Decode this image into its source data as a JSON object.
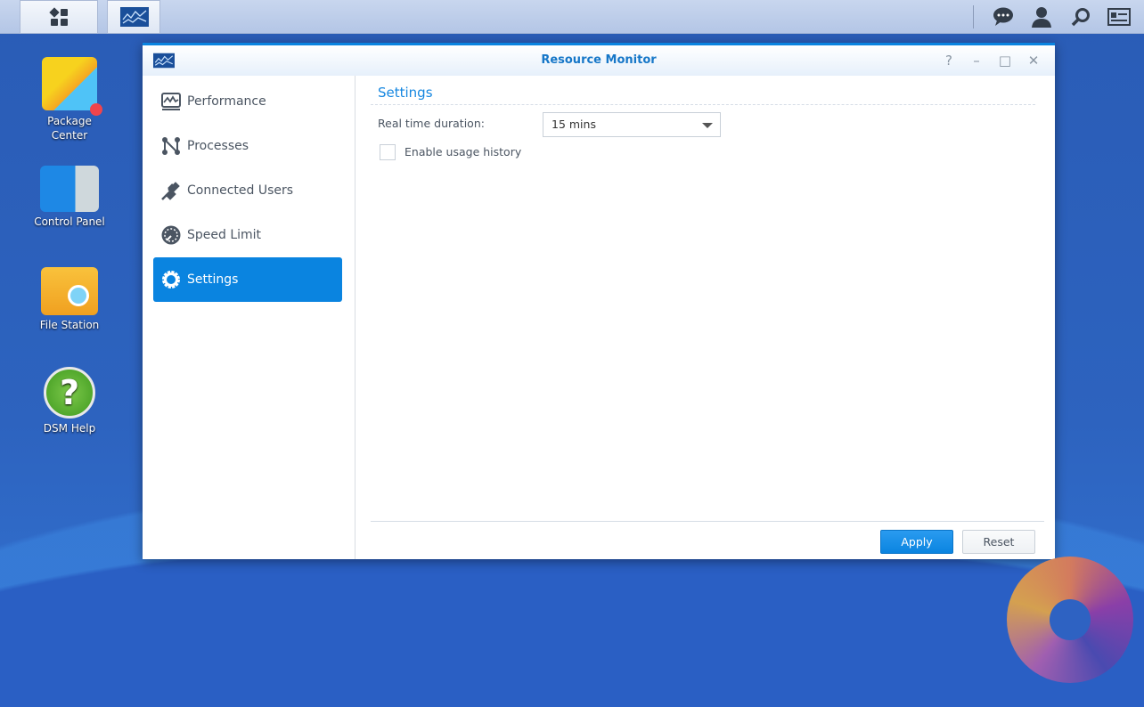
{
  "taskbar": {
    "main_menu": "main-menu",
    "app": "resource-monitor"
  },
  "desktop": {
    "icons": [
      {
        "label": "Package Center"
      },
      {
        "label": "Control Panel"
      },
      {
        "label": "File Station"
      },
      {
        "label": "DSM Help"
      }
    ]
  },
  "window": {
    "title": "Resource Monitor",
    "controls": {
      "help": "?",
      "minimize": "–",
      "maximize": "□",
      "close": "✕"
    }
  },
  "sidebar": {
    "items": [
      {
        "label": "Performance"
      },
      {
        "label": "Processes"
      },
      {
        "label": "Connected Users"
      },
      {
        "label": "Speed Limit"
      },
      {
        "label": "Settings",
        "active": true
      }
    ]
  },
  "settings": {
    "heading": "Settings",
    "duration_label": "Real time duration:",
    "duration_value": "15 mins",
    "history_label": "Enable usage history",
    "history_checked": false
  },
  "footer": {
    "apply": "Apply",
    "reset": "Reset"
  },
  "colors": {
    "accent": "#0a84e0"
  }
}
